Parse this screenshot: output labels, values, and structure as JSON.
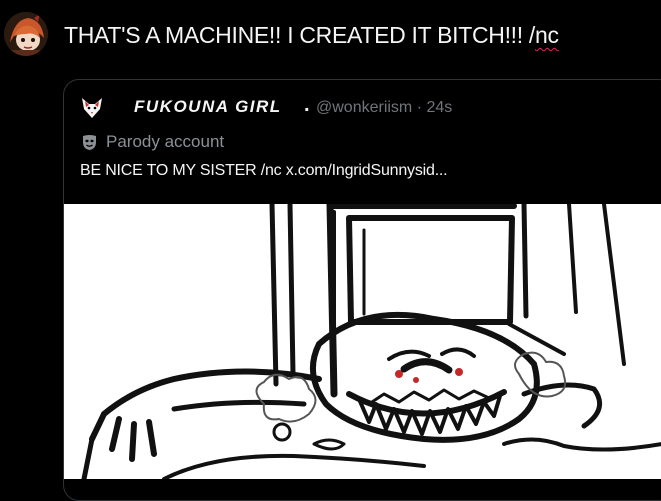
{
  "post": {
    "text_main": "THAT'S A MACHINE!! I CREATED IT BITCH!!! /",
    "text_marked": "nc",
    "avatar_icon": "user-avatar-icon"
  },
  "quote": {
    "display_name": "FUKOUNA  GIRL",
    "name_suffix": ".",
    "handle_time": "@wonkeriism · 24s",
    "parody_label": "Parody account",
    "text": "BE NICE TO MY SISTER /nc  x.com/IngridSunnysid...",
    "avatar_icon": "fox-avatar-icon",
    "parody_icon": "theater-masks-icon"
  },
  "colors": {
    "background": "#000000",
    "text": "#f5f5f5",
    "muted": "#71767b",
    "border": "#2f3336",
    "spellcheck": "#e0245e"
  }
}
